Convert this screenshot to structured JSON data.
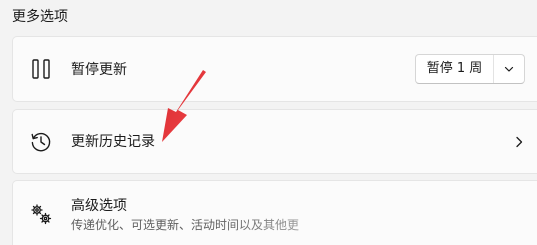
{
  "section": {
    "title": "更多选项"
  },
  "pause_updates": {
    "title": "暂停更新",
    "icon": "pause-icon",
    "dropdown": {
      "selected": "暂停 1 周",
      "icon": "chevron-down-icon"
    }
  },
  "update_history": {
    "title": "更新历史记录",
    "icon": "history-icon",
    "nav_icon": "chevron-right-icon"
  },
  "advanced_options": {
    "title": "高级选项",
    "subtitle": "传递优化、可选更新、活动时间以及其他更",
    "icon": "gears-icon"
  },
  "colors": {
    "background": "#f3f3f3",
    "card": "#fbfbfb",
    "annotation_arrow": "#e8343a",
    "secondary_text": "#5f5f5f"
  }
}
